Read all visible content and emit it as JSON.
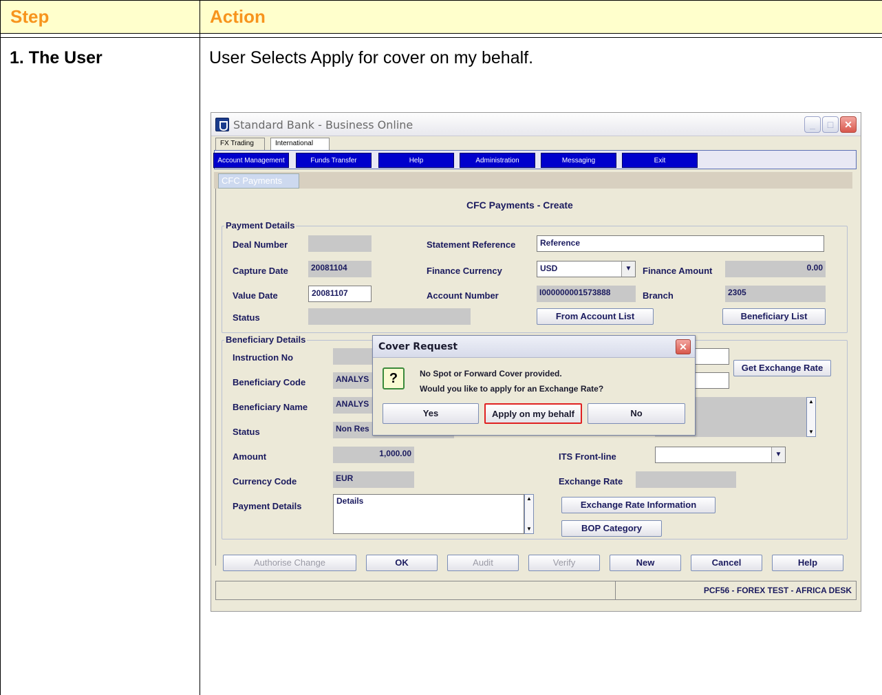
{
  "doc": {
    "step_header": "Step",
    "action_header": "Action",
    "step_1": "1. The User",
    "action_1": "User Selects Apply for cover on my behalf."
  },
  "window": {
    "title": "Standard Bank - Business Online",
    "top_tabs": [
      "FX Trading",
      "International"
    ],
    "menu": [
      "Account Management",
      "Funds Transfer",
      "Help",
      "Administration",
      "Messaging",
      "Exit"
    ],
    "subtab": "CFC Payments"
  },
  "form": {
    "title": "CFC Payments - Create",
    "payment_group": "Payment Details",
    "deal_number_label": "Deal Number",
    "deal_number_value": "",
    "capture_date_label": "Capture Date",
    "capture_date_value": "20081104",
    "value_date_label": "Value Date",
    "value_date_value": "20081107",
    "status_label": "Status",
    "status_value": "",
    "statement_ref_label": "Statement Reference",
    "statement_ref_value": "Reference",
    "finance_currency_label": "Finance Currency",
    "finance_currency_value": "USD",
    "finance_amount_label": "Finance Amount",
    "finance_amount_value": "0.00",
    "account_number_label": "Account Number",
    "account_number_value": "I000000001573888",
    "branch_label": "Branch",
    "branch_value": "2305",
    "from_account_list": "From Account List",
    "beneficiary_list": "Beneficiary List",
    "beneficiary_group": "Beneficiary Details",
    "instruction_no_label": "Instruction No",
    "beneficiary_code_label": "Beneficiary Code",
    "beneficiary_code_value": "ANALYS",
    "beneficiary_name_label": "Beneficiary Name",
    "beneficiary_name_value": "ANALYS",
    "ben_status_label": "Status",
    "ben_status_value": "Non Res",
    "amount_label": "Amount",
    "amount_value": "1,000.00",
    "currency_code_label": "Currency Code",
    "currency_code_value": "EUR",
    "payment_details_label": "Payment Details",
    "payment_details_value": "Details",
    "get_exchange_rate": "Get Exchange Rate",
    "its_front_line_label": "ITS Front-line",
    "exchange_rate_label": "Exchange Rate",
    "exchange_rate_info": "Exchange Rate Information",
    "bop_category": "BOP Category"
  },
  "footer_buttons": [
    "Authorise Change",
    "OK",
    "Audit",
    "Verify",
    "New",
    "Cancel",
    "Help"
  ],
  "status_text": "PCF56 - FOREX TEST - AFRICA DESK",
  "dialog": {
    "title": "Cover Request",
    "msg1": "No Spot or Forward Cover provided.",
    "msg2": "Would you like to apply for an Exchange Rate?",
    "yes": "Yes",
    "apply": "Apply on my behalf",
    "no": "No",
    "highlight_color": "#e02020"
  },
  "colors": {
    "header_text": "#f7941d",
    "header_bg": "#ffffcc",
    "menu_bg": "#0000cc"
  }
}
